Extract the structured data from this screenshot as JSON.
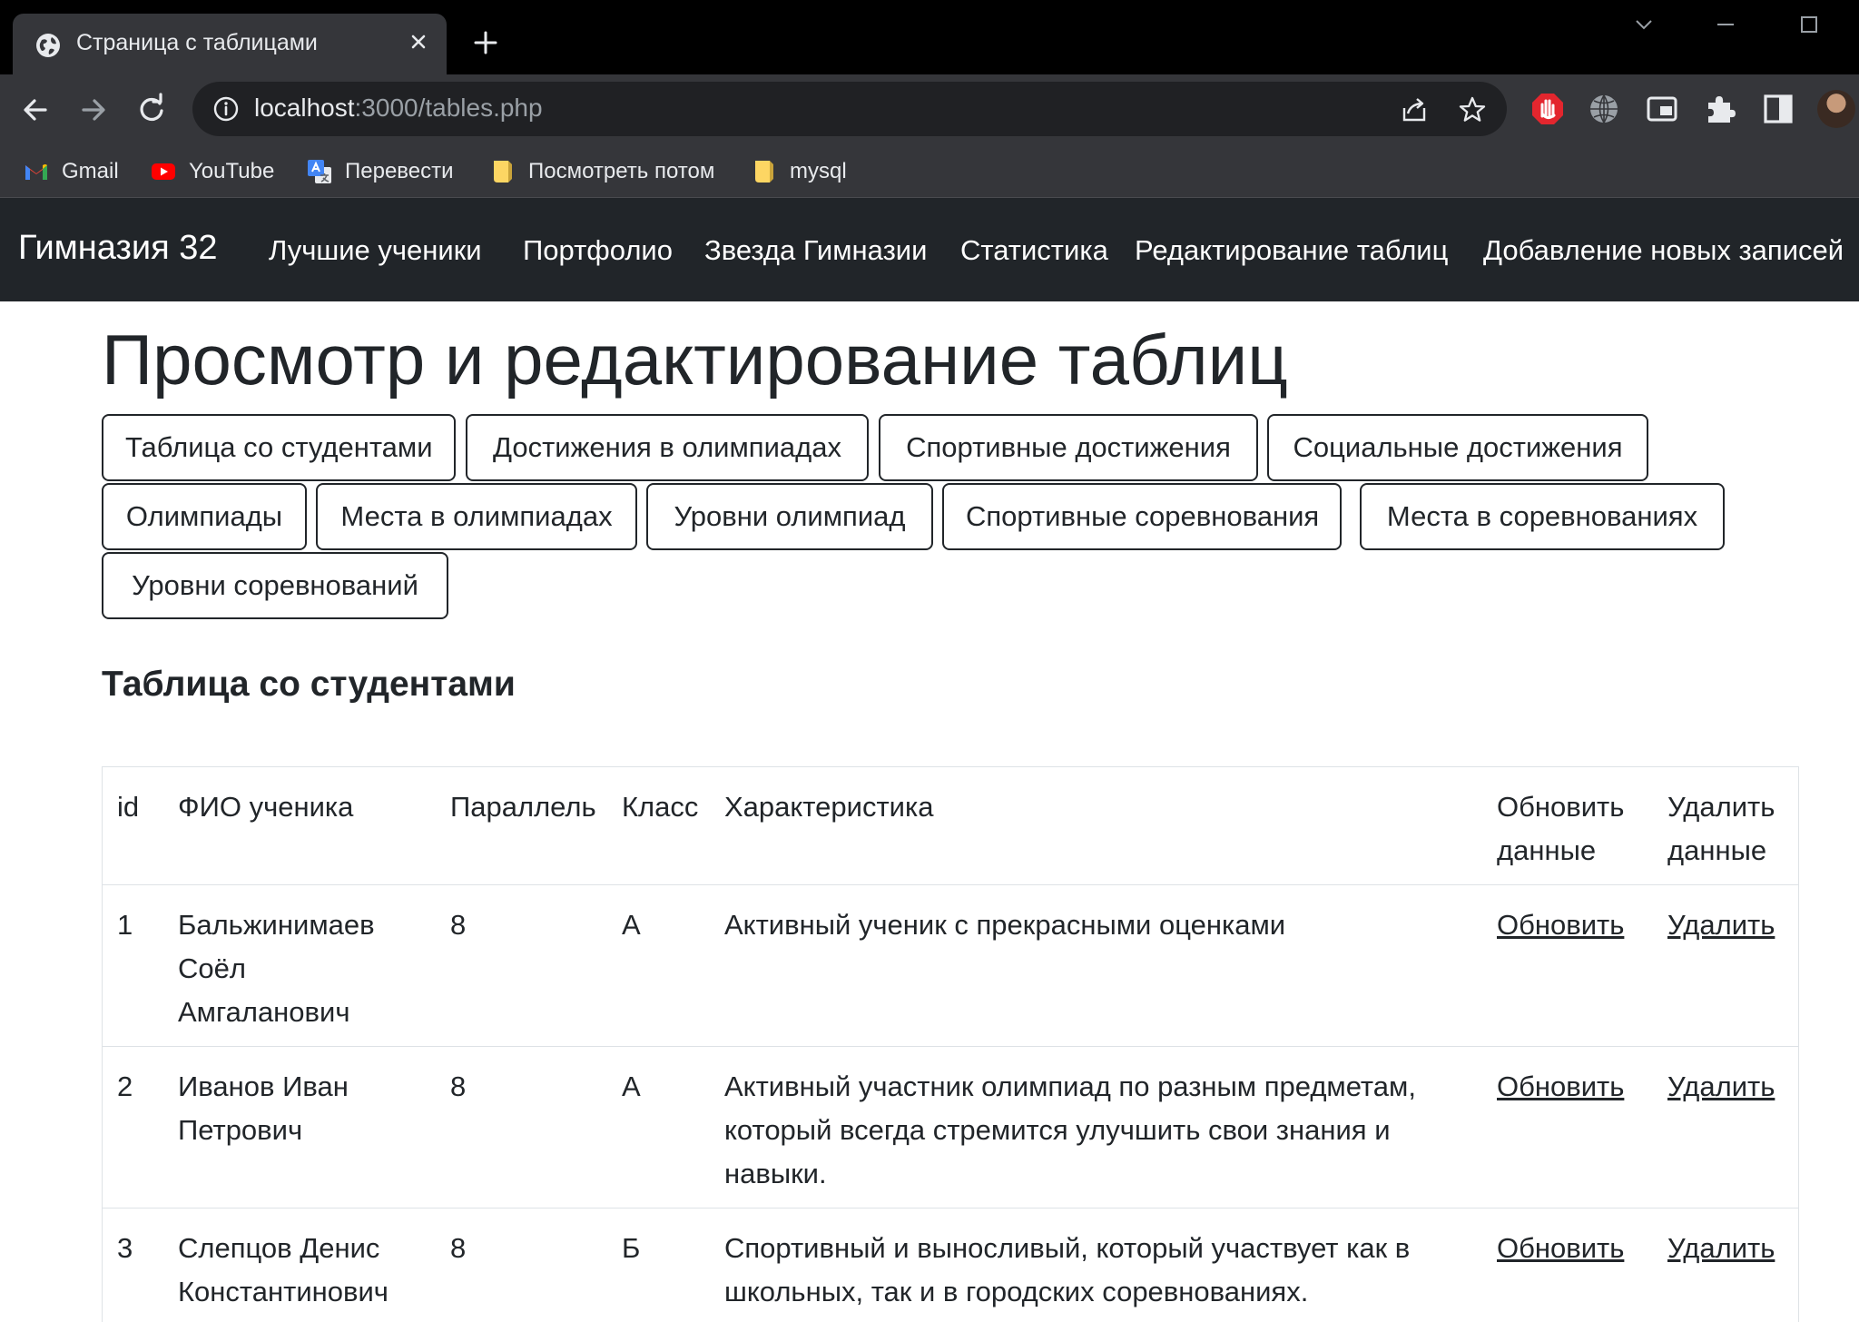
{
  "browser": {
    "tab_title": "Страница с таблицами",
    "url_host": "localhost",
    "url_path": ":3000/tables.php",
    "bookmarks": [
      {
        "label": "Gmail",
        "icon": "gmail-icon"
      },
      {
        "label": "YouTube",
        "icon": "youtube-icon"
      },
      {
        "label": "Перевести",
        "icon": "translate-icon"
      },
      {
        "label": "Посмотреть потом",
        "icon": "folder-icon"
      },
      {
        "label": "mysql",
        "icon": "folder-icon"
      }
    ]
  },
  "navbar": {
    "brand": "Гимназия 32",
    "links": [
      "Лучшие ученики",
      "Портфолио",
      "Звезда Гимназии",
      "Статистика",
      "Редактирование таблиц",
      "Добавление новых записей"
    ]
  },
  "page": {
    "title": "Просмотр и редактирование таблиц",
    "buttons": [
      "Таблица со студентами",
      "Достижения в олимпиадах",
      "Спортивные достижения",
      "Социальные достижения",
      "Олимпиады",
      "Места в олимпиадах",
      "Уровни олимпиад",
      "Спортивные соревнования",
      "Места в соревнованиях",
      "Уровни соревнований"
    ],
    "section_title": "Таблица со студентами"
  },
  "table": {
    "headers": {
      "id": "id",
      "name": "ФИО ученика",
      "parallel": "Параллель",
      "class": "Класс",
      "desc": "Характеристика",
      "update_1": "Обновить",
      "update_2": "данные",
      "delete_1": "Удалить",
      "delete_2": "данные"
    },
    "rows": [
      {
        "id": "1",
        "name_lines": [
          "Бальжинимаев",
          "Соёл",
          "Амгаланович"
        ],
        "parallel": "8",
        "class": "А",
        "desc_lines": [
          "Активный ученик с прекрасными оценками"
        ],
        "update": "Обновить",
        "delete": "Удалить"
      },
      {
        "id": "2",
        "name_lines": [
          "Иванов Иван",
          "Петрович"
        ],
        "parallel": "8",
        "class": "А",
        "desc_lines": [
          "Активный участник олимпиад по разным предметам,",
          "который всегда стремится улучшить свои знания и",
          "навыки."
        ],
        "update": "Обновить",
        "delete": "Удалить"
      },
      {
        "id": "3",
        "name_lines": [
          "Слепцов Денис",
          "Константинович"
        ],
        "parallel": "8",
        "class": "Б",
        "desc_lines": [
          "Спортивный и выносливый, который участвует как в",
          "школьных, так и в городских соревнованиях."
        ],
        "update": "Обновить",
        "delete": "Удалить"
      }
    ]
  }
}
